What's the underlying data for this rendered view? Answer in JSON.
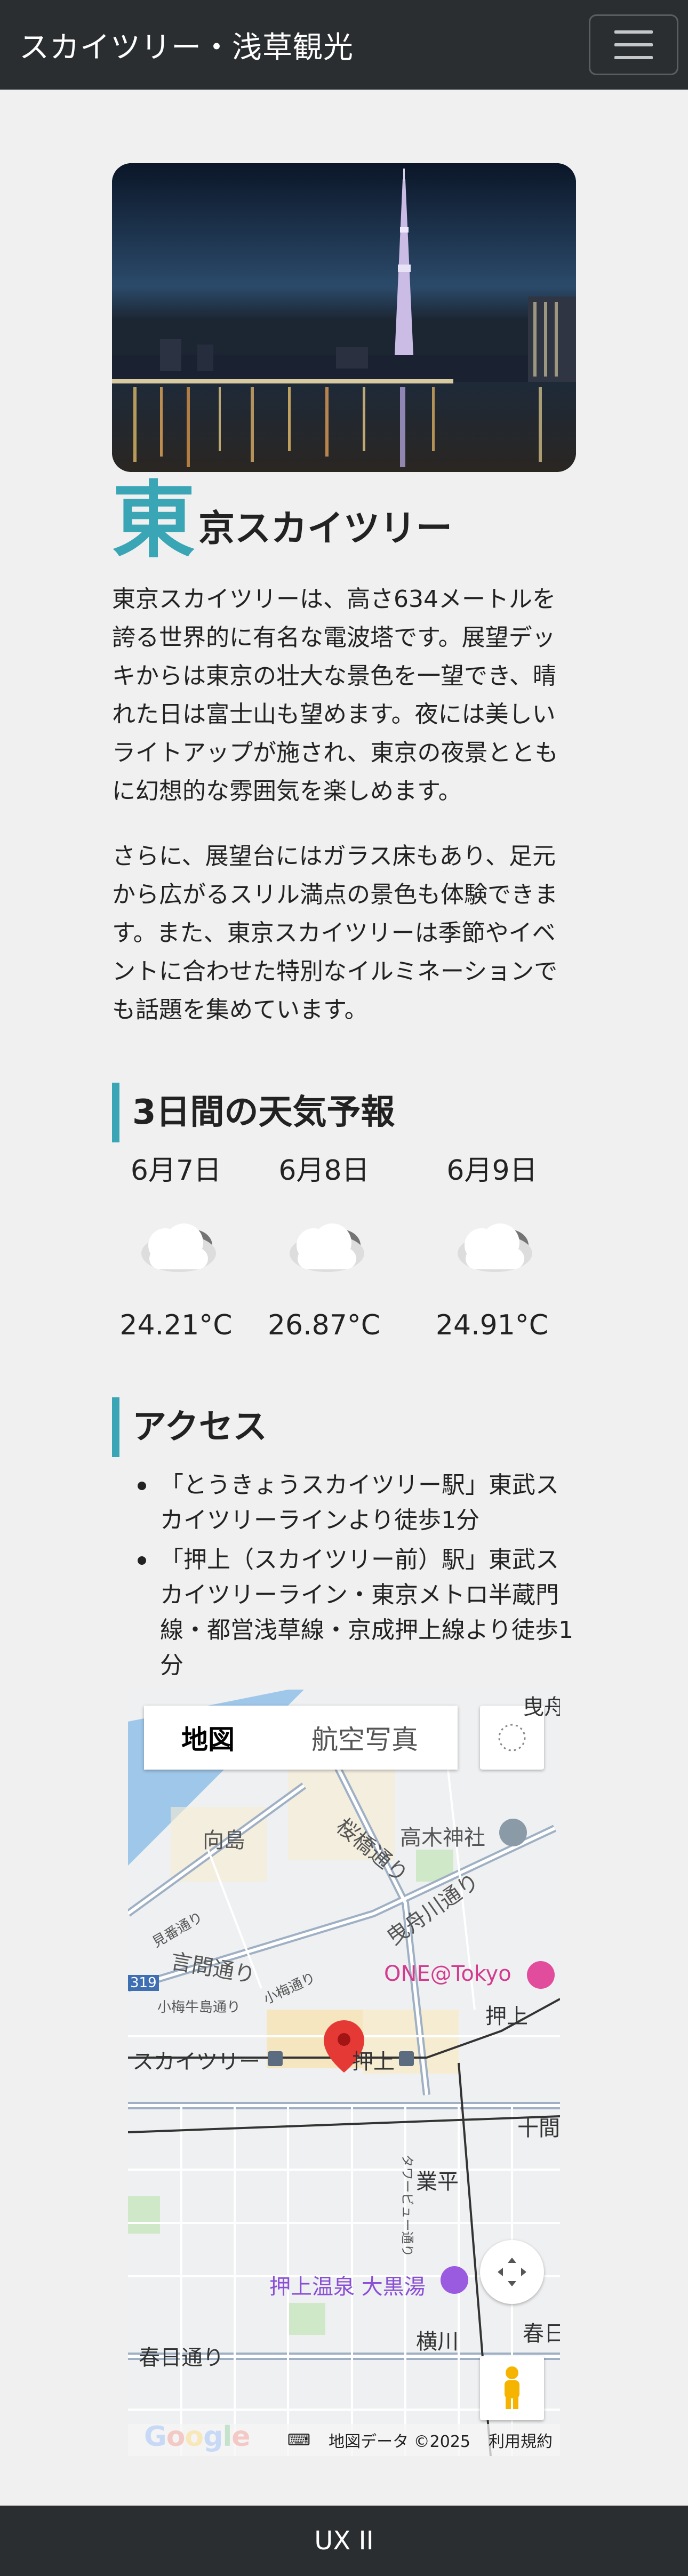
{
  "header": {
    "brand": "スカイツリー・浅草観光",
    "menu_icon": "hamburger-icon"
  },
  "hero": {
    "alt": "東京スカイツリー夜景"
  },
  "title": {
    "first_char": "東",
    "rest": "京スカイツリー"
  },
  "intro": {
    "p1": "東京スカイツリーは、高さ634メートルを誇る世界的に有名な電波塔です。展望デッキからは東京の壮大な景色を一望でき、晴れた日は富士山も望めます。夜には美しいライトアップが施され、東京の夜景とともに幻想的な雰囲気を楽しめます。",
    "p2": "さらに、展望台にはガラス床もあり、足元から広がるスリル満点の景色も体験できます。また、東京スカイツリーは季節やイベントに合わせた特別なイルミネーションでも話題を集めています。"
  },
  "weather": {
    "heading": "3日間の天気予報",
    "days": [
      {
        "date": "6月7日",
        "icon": "cloud-icon",
        "temp": "24.21°C"
      },
      {
        "date": "6月8日",
        "icon": "cloud-icon",
        "temp": "26.87°C"
      },
      {
        "date": "6月9日",
        "icon": "cloud-icon",
        "temp": "24.91°C"
      }
    ]
  },
  "access": {
    "heading": "アクセス",
    "items": [
      "「とうきょうスカイツリー駅」東武スカイツリーラインより徒歩1分",
      "「押上（スカイツリー前）駅」東武スカイツリーライン・東京メトロ半蔵門線・都営浅草線・京成押上線より徒歩1分"
    ]
  },
  "map": {
    "tab_map": "地図",
    "tab_satellite": "航空写真",
    "labels": {
      "mukoujima": "向島",
      "sakurabashi": "桜橋通り",
      "takagi": "高木神社",
      "kenshi": "見番通り",
      "hikifune": "曳舟川通り",
      "kototoi": "言問通り",
      "one_tokyo": "ONE@Tokyo",
      "oshiage": "押上",
      "route": "319",
      "koume": "小梅通り",
      "koumeushi": "小梅牛島通り",
      "skytree": "スカイツリー",
      "oshiage_station": "押上",
      "jukken": "十間",
      "tower_view": "タワービュー通り",
      "narihira": "業平",
      "onsen": "押上温泉 大黒湯",
      "yokokawa": "横川",
      "kasuga_left": "春日通り",
      "kasuga_right": "春日",
      "top_right": "曳舟"
    },
    "footer": {
      "google": "Google",
      "data": "地図データ ©2025",
      "terms": "利用規約"
    }
  },
  "footer": {
    "text": "UX II"
  },
  "colors": {
    "accent": "#3aa6b5",
    "nav_bg": "#2b2e31",
    "page_bg": "#f0f0f0"
  }
}
